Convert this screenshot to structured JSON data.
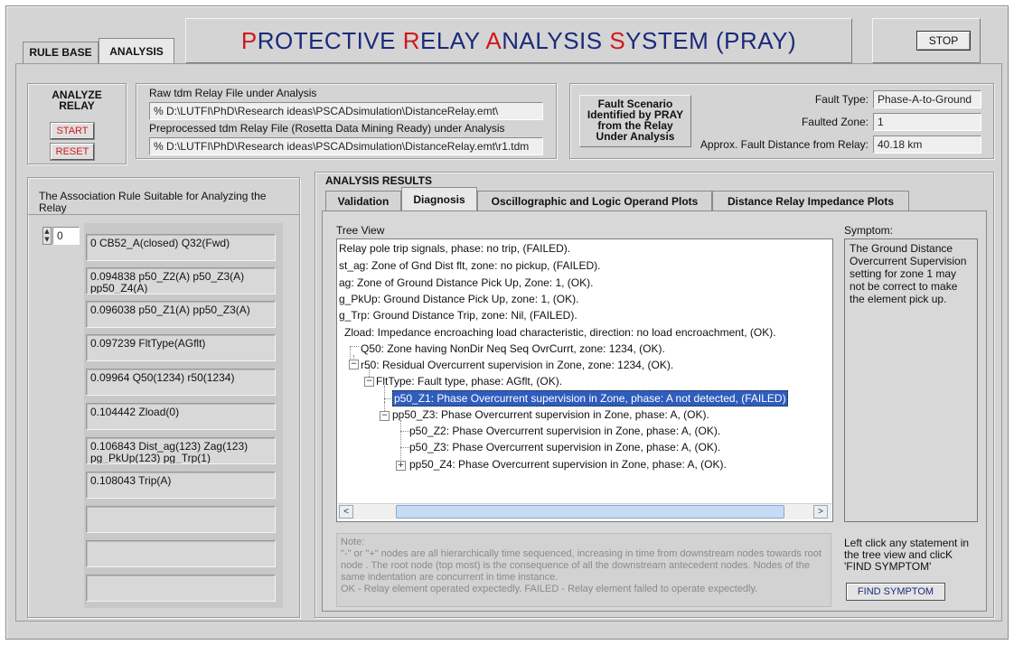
{
  "tabs": {
    "rule_base": "RULE BASE",
    "analysis": "ANALYSIS"
  },
  "app_title": {
    "p1": "P",
    "t1": "ROTECTIVE ",
    "p2": "R",
    "t2": "ELAY ",
    "p3": "A",
    "t3": "NALYSIS ",
    "p4": "S",
    "t4": "YSTEM  (PRAY)"
  },
  "stop_button": "STOP",
  "analyze": {
    "label_line1": "ANALYZE",
    "label_line2": "RELAY",
    "start": "START",
    "reset": "RESET"
  },
  "files": {
    "raw_label": "Raw tdm Relay File under Analysis",
    "raw_path": "D:\\LUTFI\\PhD\\Research ideas\\PSCADsimulation\\DistanceRelay.emt\\",
    "pre_label": "Preprocessed tdm Relay File  (Rosetta Data Mining Ready) under Analysis",
    "pre_path": "D:\\LUTFI\\PhD\\Research ideas\\PSCADsimulation\\DistanceRelay.emt\\r1.tdm",
    "path_prefix": "%"
  },
  "fault": {
    "box_label_lines": [
      "Fault Scenario",
      "Identified by PRAY",
      "from the Relay",
      "Under Analysis"
    ],
    "type_label": "Fault Type:",
    "type_value": "Phase-A-to-Ground",
    "zone_label": "Faulted Zone:",
    "zone_value": "1",
    "distance_label": "Approx. Fault Distance from Relay:",
    "distance_value": "40.18 km"
  },
  "rules": {
    "heading": "The Association Rule Suitable for Analyzing the Relay",
    "index": "0",
    "items": [
      "0 CB52_A(closed) Q32(Fwd)",
      "0.094838 p50_Z2(A) p50_Z3(A) pp50_Z4(A)",
      "0.096038 p50_Z1(A) pp50_Z3(A)",
      "0.097239 FltType(AGflt)",
      "0.09964 Q50(1234) r50(1234)",
      "0.104442 Zload(0)",
      "0.106843 Dist_ag(123) Zag(123) pg_PkUp(123) pg_Trp(1)",
      "0.108043 Trip(A)",
      "",
      "",
      ""
    ]
  },
  "results": {
    "heading": "ANALYSIS RESULTS",
    "tabs": [
      "Validation",
      "Diagnosis",
      "Oscillographic and Logic Operand Plots",
      "Distance Relay Impedance Plots"
    ],
    "tree_label": "Tree View",
    "tree_rows": [
      "Relay pole trip signals, phase: no trip, (FAILED).",
      "st_ag: Zone of Gnd Dist flt, zone: no pickup, (FAILED).",
      "ag: Zone of Ground Distance Pick Up, Zone: 1, (OK).",
      "g_PkUp: Ground Distance Pick Up, zone: 1, (OK).",
      "g_Trp: Ground Distance Trip, zone: Nil, (FAILED).",
      "Zload: Impedance encroaching load characteristic, direction: no load encroachment, (OK).",
      "Q50: Zone having NonDir Neq Seq OvrCurrt, zone: 1234, (OK).",
      "r50: Residual Overcurrent supervision in Zone, zone: 1234, (OK).",
      "FltType: Fault type, phase: AGflt, (OK).",
      "p50_Z1: Phase Overcurrent supervision in Zone, phase: A not detected, (FAILED)",
      "pp50_Z3: Phase Overcurrent supervision in Zone, phase: A, (OK).",
      "p50_Z2: Phase Overcurrent supervision in Zone, phase: A, (OK).",
      "p50_Z3: Phase Overcurrent supervision in Zone, phase: A, (OK).",
      "pp50_Z4: Phase Overcurrent supervision in Zone, phase: A, (OK)."
    ],
    "symptom_label": "Symptom:",
    "symptom_text": "The Ground Distance Overcurrent Supervision setting for zone 1 may not be correct to make the element pick up.",
    "note_label": "Note:",
    "note_text": "\"-\" or \"+\" nodes are all hierarchically time sequenced, increasing in time from downstream nodes towards root node . The root node (top most)  is the consequence of all the downstream antecedent nodes. Nodes of the same indentation are concurrent in time instance.",
    "note_legend": "OK - Relay element operated expectedly. FAILED - Relay element failed to operate expectedly.",
    "instruction": "Left click any statement in the tree view and clicK 'FIND SYMPTOM'",
    "find_symptom": "FIND SYMPTOM"
  },
  "colors": {
    "title_blue": "#1a2a7a",
    "title_red": "#d01818",
    "selection": "#2f5dbd",
    "panel": "#d4d4d4"
  }
}
